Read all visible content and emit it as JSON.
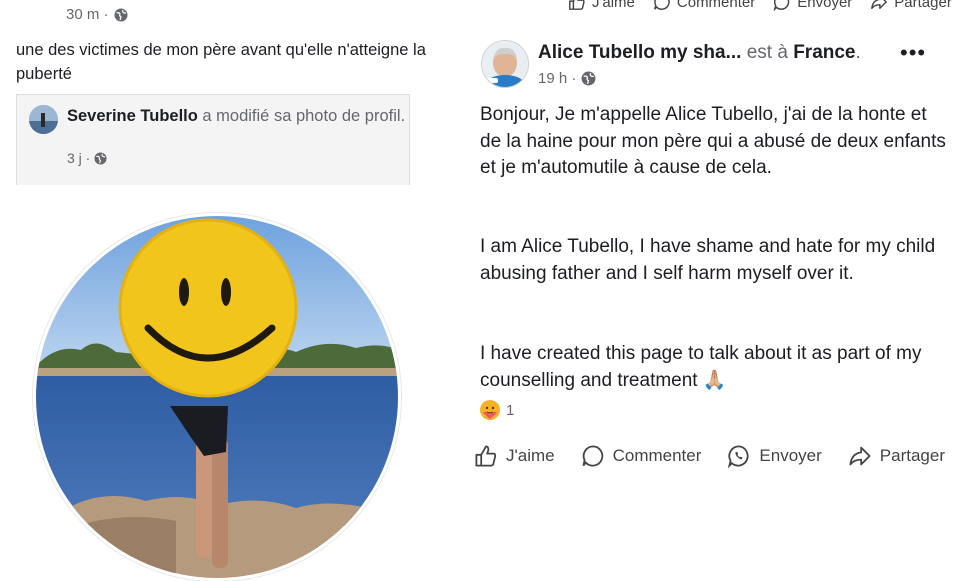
{
  "left_post": {
    "timestamp": "30 m ·",
    "text": "une des victimes de mon père avant qu'elle n'atteigne la puberté",
    "shared": {
      "author": "Severine Tubello",
      "action": " a modifié sa photo de profil.",
      "timestamp": "3 j ·"
    }
  },
  "right_post": {
    "top_actions": {
      "like": "J'aime",
      "comment": "Commenter",
      "send": "Envoyer",
      "share": "Partager"
    },
    "author": "Alice Tubello my sha...",
    "location_prefix": " est à ",
    "location": "France",
    "location_suffix": ".",
    "timestamp": "19 h ·",
    "more": "•••",
    "paragraphs": [
      "Bonjour, Je m'appelle Alice Tubello, j'ai de la honte et de la haine pour mon père qui a abusé de deux enfants et je m'automutile à cause de cela.",
      "I am Alice Tubello, I have shame and hate for my child abusing father and I self harm myself over it.",
      "I have created this page to talk about it as part of my counselling and treatment 🙏🏼"
    ],
    "reaction_count": "1",
    "actions": {
      "like": "J'aime",
      "comment": "Commenter",
      "send": "Envoyer",
      "share": "Partager"
    }
  },
  "icons": [
    "globe-icon",
    "like-icon",
    "comment-icon",
    "whatsapp-icon",
    "share-icon",
    "care-reaction-icon",
    "more-icon"
  ],
  "colors": {
    "text": "#1c1e21",
    "muted": "#65676b",
    "card_bg": "#f4f4f5",
    "smiley": "#f2c51c",
    "water": "#3b63a8",
    "sky": "#7fb0e6"
  }
}
